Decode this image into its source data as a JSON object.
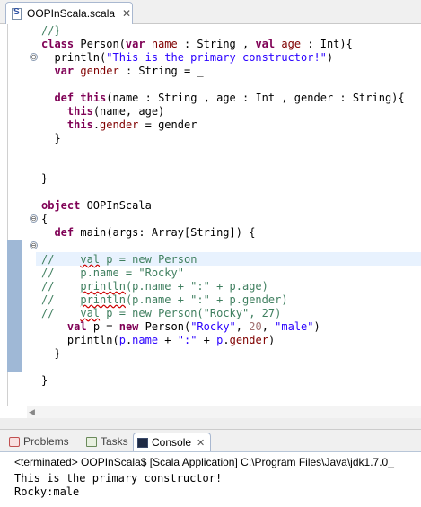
{
  "editor_tab": {
    "filename": "OOPInScala.scala",
    "close_glyph": "✕"
  },
  "code_lines": [
    [
      {
        "t": "//}",
        "c": "cm"
      }
    ],
    [
      {
        "t": "class",
        "c": "kw"
      },
      {
        "t": " Person(",
        "c": ""
      },
      {
        "t": "var",
        "c": "kw"
      },
      {
        "t": " ",
        "c": ""
      },
      {
        "t": "name",
        "c": "fld"
      },
      {
        "t": " : String , ",
        "c": ""
      },
      {
        "t": "val",
        "c": "kw"
      },
      {
        "t": " ",
        "c": ""
      },
      {
        "t": "age",
        "c": "fld"
      },
      {
        "t": " : Int){",
        "c": ""
      }
    ],
    [
      {
        "t": "  println(",
        "c": ""
      },
      {
        "t": "\"This is the primary constructor!\"",
        "c": "str"
      },
      {
        "t": ")",
        "c": ""
      }
    ],
    [
      {
        "t": "  ",
        "c": ""
      },
      {
        "t": "var",
        "c": "kw"
      },
      {
        "t": " ",
        "c": ""
      },
      {
        "t": "gender",
        "c": "fld"
      },
      {
        "t": " : String = _",
        "c": ""
      }
    ],
    [
      {
        "t": "",
        "c": ""
      }
    ],
    [
      {
        "t": "  ",
        "c": ""
      },
      {
        "t": "def",
        "c": "kw"
      },
      {
        "t": " ",
        "c": ""
      },
      {
        "t": "this",
        "c": "kw"
      },
      {
        "t": "(name : String , age : Int , gender : String){",
        "c": ""
      }
    ],
    [
      {
        "t": "    ",
        "c": ""
      },
      {
        "t": "this",
        "c": "kw"
      },
      {
        "t": "(name, age)",
        "c": ""
      }
    ],
    [
      {
        "t": "    ",
        "c": ""
      },
      {
        "t": "this",
        "c": "kw"
      },
      {
        "t": ".",
        "c": ""
      },
      {
        "t": "gender",
        "c": "fld"
      },
      {
        "t": " = gender",
        "c": ""
      }
    ],
    [
      {
        "t": "  }",
        "c": ""
      }
    ],
    [
      {
        "t": "",
        "c": ""
      }
    ],
    [
      {
        "t": "",
        "c": ""
      }
    ],
    [
      {
        "t": "}",
        "c": ""
      }
    ],
    [
      {
        "t": "",
        "c": ""
      }
    ],
    [
      {
        "t": "object",
        "c": "kw"
      },
      {
        "t": " OOPInScala",
        "c": ""
      }
    ],
    [
      {
        "t": "{",
        "c": ""
      }
    ],
    [
      {
        "t": "  ",
        "c": ""
      },
      {
        "t": "def",
        "c": "kw"
      },
      {
        "t": " main(args: Array[String]) {",
        "c": ""
      }
    ],
    [
      {
        "t": "",
        "c": ""
      }
    ],
    [
      {
        "t": "//    ",
        "c": "cm"
      },
      {
        "t": "val",
        "c": "cm squig"
      },
      {
        "t": " p = new Person",
        "c": "cm"
      }
    ],
    [
      {
        "t": "//    p.name = \"Rocky\"",
        "c": "cm"
      }
    ],
    [
      {
        "t": "//    ",
        "c": "cm"
      },
      {
        "t": "println",
        "c": "cm squig"
      },
      {
        "t": "(p.name + \":\" + p.age)",
        "c": "cm"
      }
    ],
    [
      {
        "t": "//    ",
        "c": "cm"
      },
      {
        "t": "println",
        "c": "cm squig"
      },
      {
        "t": "(p.name + \":\" + p.gender)",
        "c": "cm"
      }
    ],
    [
      {
        "t": "//    ",
        "c": "cm"
      },
      {
        "t": "val",
        "c": "cm squig"
      },
      {
        "t": " p = new Person(\"Rocky\", 27)",
        "c": "cm"
      }
    ],
    [
      {
        "t": "    ",
        "c": ""
      },
      {
        "t": "val",
        "c": "kw"
      },
      {
        "t": " p = ",
        "c": ""
      },
      {
        "t": "new",
        "c": "kw"
      },
      {
        "t": " Person(",
        "c": ""
      },
      {
        "t": "\"Rocky\"",
        "c": "str"
      },
      {
        "t": ", ",
        "c": ""
      },
      {
        "t": "20",
        "c": "num"
      },
      {
        "t": ", ",
        "c": ""
      },
      {
        "t": "\"male\"",
        "c": "str"
      },
      {
        "t": ")",
        "c": ""
      }
    ],
    [
      {
        "t": "    println(",
        "c": ""
      },
      {
        "t": "p",
        "c": "str"
      },
      {
        "t": ".",
        "c": ""
      },
      {
        "t": "name",
        "c": "str"
      },
      {
        "t": " + ",
        "c": ""
      },
      {
        "t": "\":\"",
        "c": "str"
      },
      {
        "t": " + ",
        "c": ""
      },
      {
        "t": "p",
        "c": "str"
      },
      {
        "t": ".",
        "c": ""
      },
      {
        "t": "gender",
        "c": "fld"
      },
      {
        "t": ")",
        "c": ""
      }
    ],
    [
      {
        "t": "  }",
        "c": ""
      }
    ],
    [
      {
        "t": "",
        "c": ""
      }
    ],
    [
      {
        "t": "}",
        "c": ""
      }
    ]
  ],
  "fold_markers": [
    "⊖",
    "⊖",
    "⊖"
  ],
  "panel_tabs": {
    "problems": "Problems",
    "tasks": "Tasks",
    "console": "Console",
    "close_glyph": "✕"
  },
  "console": {
    "terminated_line": "<terminated> OOPInScala$ [Scala Application] C:\\Program Files\\Java\\jdk1.7.0_",
    "output": [
      "This is the primary constructor!",
      "Rocky:male"
    ]
  },
  "colors": {
    "keyword": "#7f0055",
    "string": "#2a00ff",
    "comment": "#3f7f5f"
  }
}
